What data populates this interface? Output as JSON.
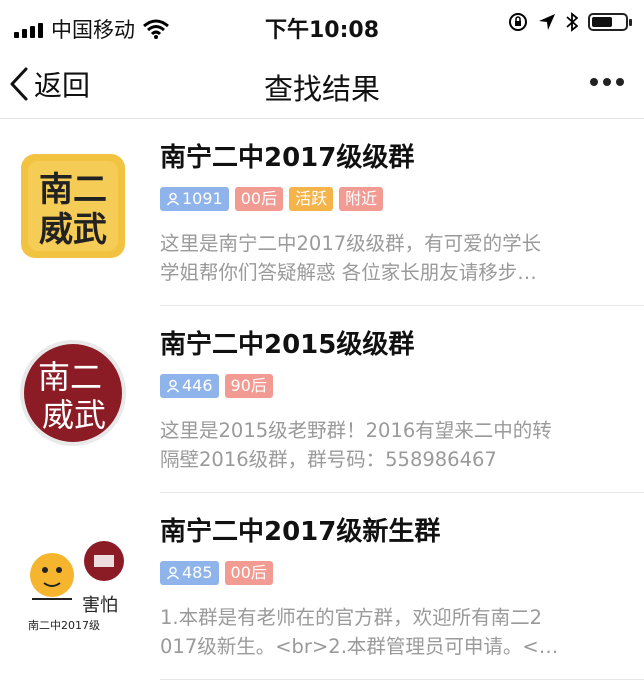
{
  "status_bar": {
    "carrier": "中国移动",
    "time": "下午10:08"
  },
  "nav": {
    "back_label": "返回",
    "title": "查找结果"
  },
  "results": [
    {
      "name": "南宁二中2017级级群",
      "members": "1091",
      "tags": [
        "00后",
        "活跃",
        "附近"
      ],
      "desc_lines": [
        "这里是南宁二中2017级级群，有可爱的学长",
        "学姐帮你们答疑解惑 各位家长朋友请移步…"
      ],
      "avatar_text": [
        "南二",
        "威武"
      ]
    },
    {
      "name": "南宁二中2015级级群",
      "members": "446",
      "tags": [
        "90后"
      ],
      "desc_lines": [
        "这里是2015级老野群！2016有望来二中的转",
        "隔壁2016级群，群号码：558986467"
      ],
      "avatar_text": [
        "南二",
        "威武"
      ]
    },
    {
      "name": "南宁二中2017级新生群",
      "members": "485",
      "tags": [
        "00后"
      ],
      "desc_lines": [
        "1.本群是有老师在的官方群，欢迎所有南二2",
        "017级新生。<br>2.本群管理员可申请。<…"
      ],
      "avatar_text": [
        "害怕",
        "南二中2017级"
      ]
    }
  ],
  "colors": {
    "member_tag": "#8fb4ec",
    "age_tag": "#f29b93",
    "active_tag": "#f5b44a",
    "desc_text": "#9a9a9a"
  }
}
